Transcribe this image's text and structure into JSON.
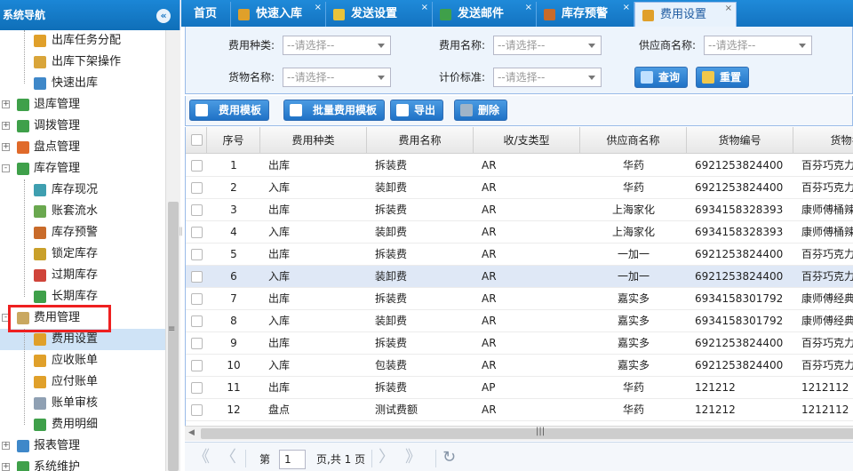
{
  "sidebar": {
    "title": "系统导航",
    "collapse_icon": "double-chevron-left-icon",
    "items": [
      {
        "level": 2,
        "label": "出库任务分配",
        "icon": "pie-chart-icon",
        "color": "#e0a02a"
      },
      {
        "level": 2,
        "label": "出库下架操作",
        "icon": "boxes-icon",
        "color": "#d9a53a"
      },
      {
        "level": 2,
        "label": "快速出库",
        "icon": "house-arrow-icon",
        "color": "#3f88c9"
      },
      {
        "level": 1,
        "label": "退库管理",
        "icon": "house-icon",
        "color": "#3fa04a",
        "expander": "+"
      },
      {
        "level": 1,
        "label": "调拨管理",
        "icon": "house-icon",
        "color": "#3fa04a",
        "expander": "+"
      },
      {
        "level": 1,
        "label": "盘点管理",
        "icon": "pie-chart-icon",
        "color": "#e06a2a",
        "expander": "+"
      },
      {
        "level": 1,
        "label": "库存管理",
        "icon": "grid-icon",
        "color": "#3fa04a",
        "expander": "-"
      },
      {
        "level": 2,
        "label": "库存现况",
        "icon": "grid-icon",
        "color": "#3f9fb0"
      },
      {
        "level": 2,
        "label": "账套流水",
        "icon": "chart-icon",
        "color": "#6aa84f"
      },
      {
        "level": 2,
        "label": "库存预警",
        "icon": "grid-icon",
        "color": "#c96b2a"
      },
      {
        "level": 2,
        "label": "锁定库存",
        "icon": "grid-icon",
        "color": "#c9a02a"
      },
      {
        "level": 2,
        "label": "过期库存",
        "icon": "grid-icon",
        "color": "#d0443a"
      },
      {
        "level": 2,
        "label": "长期库存",
        "icon": "grid-icon",
        "color": "#3fa04a"
      },
      {
        "level": 1,
        "label": "费用管理",
        "icon": "document-icon",
        "color": "#c9a860",
        "expander": "-"
      },
      {
        "level": 2,
        "label": "费用设置",
        "icon": "yen-icon",
        "color": "#e0a02a",
        "selected": true
      },
      {
        "level": 2,
        "label": "应收账单",
        "icon": "yen-icon",
        "color": "#e0a02a"
      },
      {
        "level": 2,
        "label": "应付账单",
        "icon": "document-icon",
        "color": "#e0a02a"
      },
      {
        "level": 2,
        "label": "账单审核",
        "icon": "document-icon",
        "color": "#8fa0b3"
      },
      {
        "level": 2,
        "label": "费用明细",
        "icon": "yen-icon",
        "color": "#3fa04a"
      },
      {
        "level": 1,
        "label": "报表管理",
        "icon": "grid-icon",
        "color": "#3f88c9",
        "expander": "+"
      },
      {
        "level": 1,
        "label": "系统维护",
        "icon": "tree-icon",
        "color": "#3fa04a",
        "expander": "+"
      }
    ]
  },
  "tabs": [
    {
      "label": "首页",
      "icon": "",
      "closable": false
    },
    {
      "label": "快速入库",
      "icon": "house-arrow-icon",
      "color": "#e0a02a",
      "closable": true
    },
    {
      "label": "发送设置",
      "icon": "settings-icon",
      "color": "#e9c33a",
      "closable": true
    },
    {
      "label": "发送邮件",
      "icon": "email-icon",
      "color": "#3fa04a",
      "closable": true
    },
    {
      "label": "库存预警",
      "icon": "grid-icon",
      "color": "#c96b2a",
      "closable": true
    },
    {
      "label": "费用设置",
      "icon": "yen-icon",
      "color": "#e0a02a",
      "closable": true,
      "active": true
    }
  ],
  "tab_close_glyph": "×",
  "search": {
    "fee_type_label": "费用种类:",
    "fee_name_label": "费用名称:",
    "supplier_label": "供应商名称:",
    "goods_label": "货物名称:",
    "pricing_label": "计价标准:",
    "placeholder": "--请选择--",
    "query_label": "查询",
    "reset_label": "重置"
  },
  "toolbar": {
    "fee_template_label": "费用模板",
    "batch_template_label": "批量费用模板",
    "export_label": "导出",
    "delete_label": "删除"
  },
  "grid": {
    "columns": [
      "序号",
      "费用种类",
      "费用名称",
      "收/支类型",
      "供应商名称",
      "货物编号",
      "货物名"
    ],
    "rows": [
      [
        "1",
        "出库",
        "拆装费",
        "AR",
        "华药",
        "6921253824400",
        "百芬巧克力"
      ],
      [
        "2",
        "入库",
        "装卸费",
        "AR",
        "华药",
        "6921253824400",
        "百芬巧克力"
      ],
      [
        "3",
        "出库",
        "拆装费",
        "AR",
        "上海家化",
        "6934158328393",
        "康师傅桶辣"
      ],
      [
        "4",
        "入库",
        "装卸费",
        "AR",
        "上海家化",
        "6934158328393",
        "康师傅桶辣"
      ],
      [
        "5",
        "出库",
        "拆装费",
        "AR",
        "一加一",
        "6921253824400",
        "百芬巧克力"
      ],
      [
        "6",
        "入库",
        "装卸费",
        "AR",
        "一加一",
        "6921253824400",
        "百芬巧克力"
      ],
      [
        "7",
        "出库",
        "拆装费",
        "AR",
        "嘉实多",
        "6934158301792",
        "康师傅经典"
      ],
      [
        "8",
        "入库",
        "装卸费",
        "AR",
        "嘉实多",
        "6934158301792",
        "康师傅经典"
      ],
      [
        "9",
        "出库",
        "拆装费",
        "AR",
        "嘉实多",
        "6921253824400",
        "百芬巧克力"
      ],
      [
        "10",
        "入库",
        "包装费",
        "AR",
        "嘉实多",
        "6921253824400",
        "百芬巧克力"
      ],
      [
        "11",
        "出库",
        "拆装费",
        "AP",
        "华药",
        "121212",
        "1212112"
      ],
      [
        "12",
        "盘点",
        "测试费额",
        "AR",
        "华药",
        "121212",
        "1212112"
      ]
    ],
    "selected_row": 5
  },
  "pager": {
    "page_prefix": "第",
    "page_value": "1",
    "page_suffix": "页,共 1 页",
    "first_glyph": "《",
    "prev_glyph": "〈",
    "next_glyph": "〉",
    "last_glyph": "》",
    "refresh_glyph": "↻"
  },
  "colors": {
    "header_blue": "#1373c0",
    "panel_bg": "#edf4fc",
    "button_blue": "#1f72c6",
    "selection": "#cfe3f6",
    "highlight_red": "#ee2020"
  }
}
